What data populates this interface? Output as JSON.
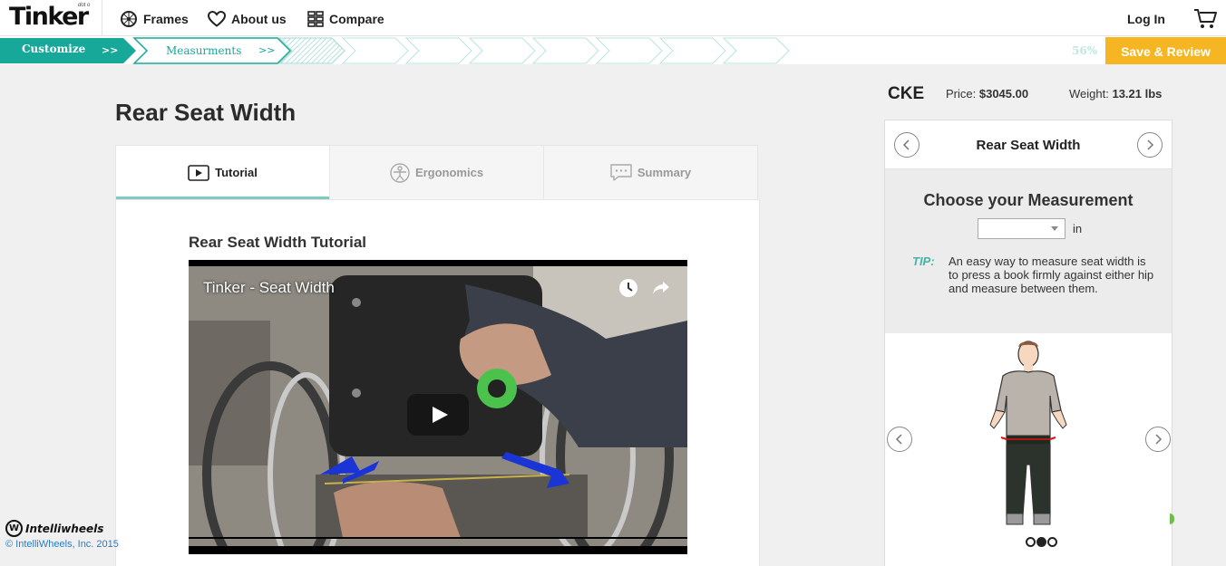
{
  "nav": {
    "logo": "Tinker",
    "logo_sup": "dot o",
    "items": [
      {
        "label": "Frames",
        "icon": "wheel-icon"
      },
      {
        "label": "About us",
        "icon": "heart-icon"
      },
      {
        "label": "Compare",
        "icon": "compare-grid-icon"
      }
    ],
    "login": "Log In",
    "cart_icon": "cart-icon"
  },
  "progress": {
    "steps": [
      {
        "label": "Customize",
        "arrows": ">>"
      },
      {
        "label": "Measurments",
        "arrows": ">>"
      }
    ],
    "percent": "56%",
    "save_label": "Save & Review"
  },
  "main": {
    "title": "Rear Seat Width",
    "tabs": [
      {
        "label": "Tutorial",
        "icon": "play-icon",
        "active": true
      },
      {
        "label": "Ergonomics",
        "icon": "vitruvian-icon",
        "active": false
      },
      {
        "label": "Summary",
        "icon": "chat-icon",
        "active": false
      }
    ],
    "tutorial_title": "Rear Seat Width Tutorial",
    "video": {
      "title": "Tinker - Seat Width",
      "icons": [
        "clock-icon",
        "share-icon"
      ]
    }
  },
  "summary": {
    "model": "CKE",
    "price_label": "Price:",
    "price": "$3045.00",
    "weight_label": "Weight:",
    "weight": "13.21 lbs"
  },
  "measure": {
    "header": "Rear Seat Width",
    "choose": "Choose your Measurement",
    "value": "",
    "unit": "in",
    "tip_label": "TIP:",
    "tip_text": "An easy way to measure seat width is to press a book firmly against either hip and measure between them."
  },
  "footer": {
    "brand": "Intelliwheels",
    "brand_mark": "W",
    "copyright": "© IntelliWheels, Inc. 2015"
  },
  "colors": {
    "teal": "#17a89a",
    "save": "#f6b623",
    "tip": "#44b4a6",
    "link": "#2a7dc6"
  }
}
